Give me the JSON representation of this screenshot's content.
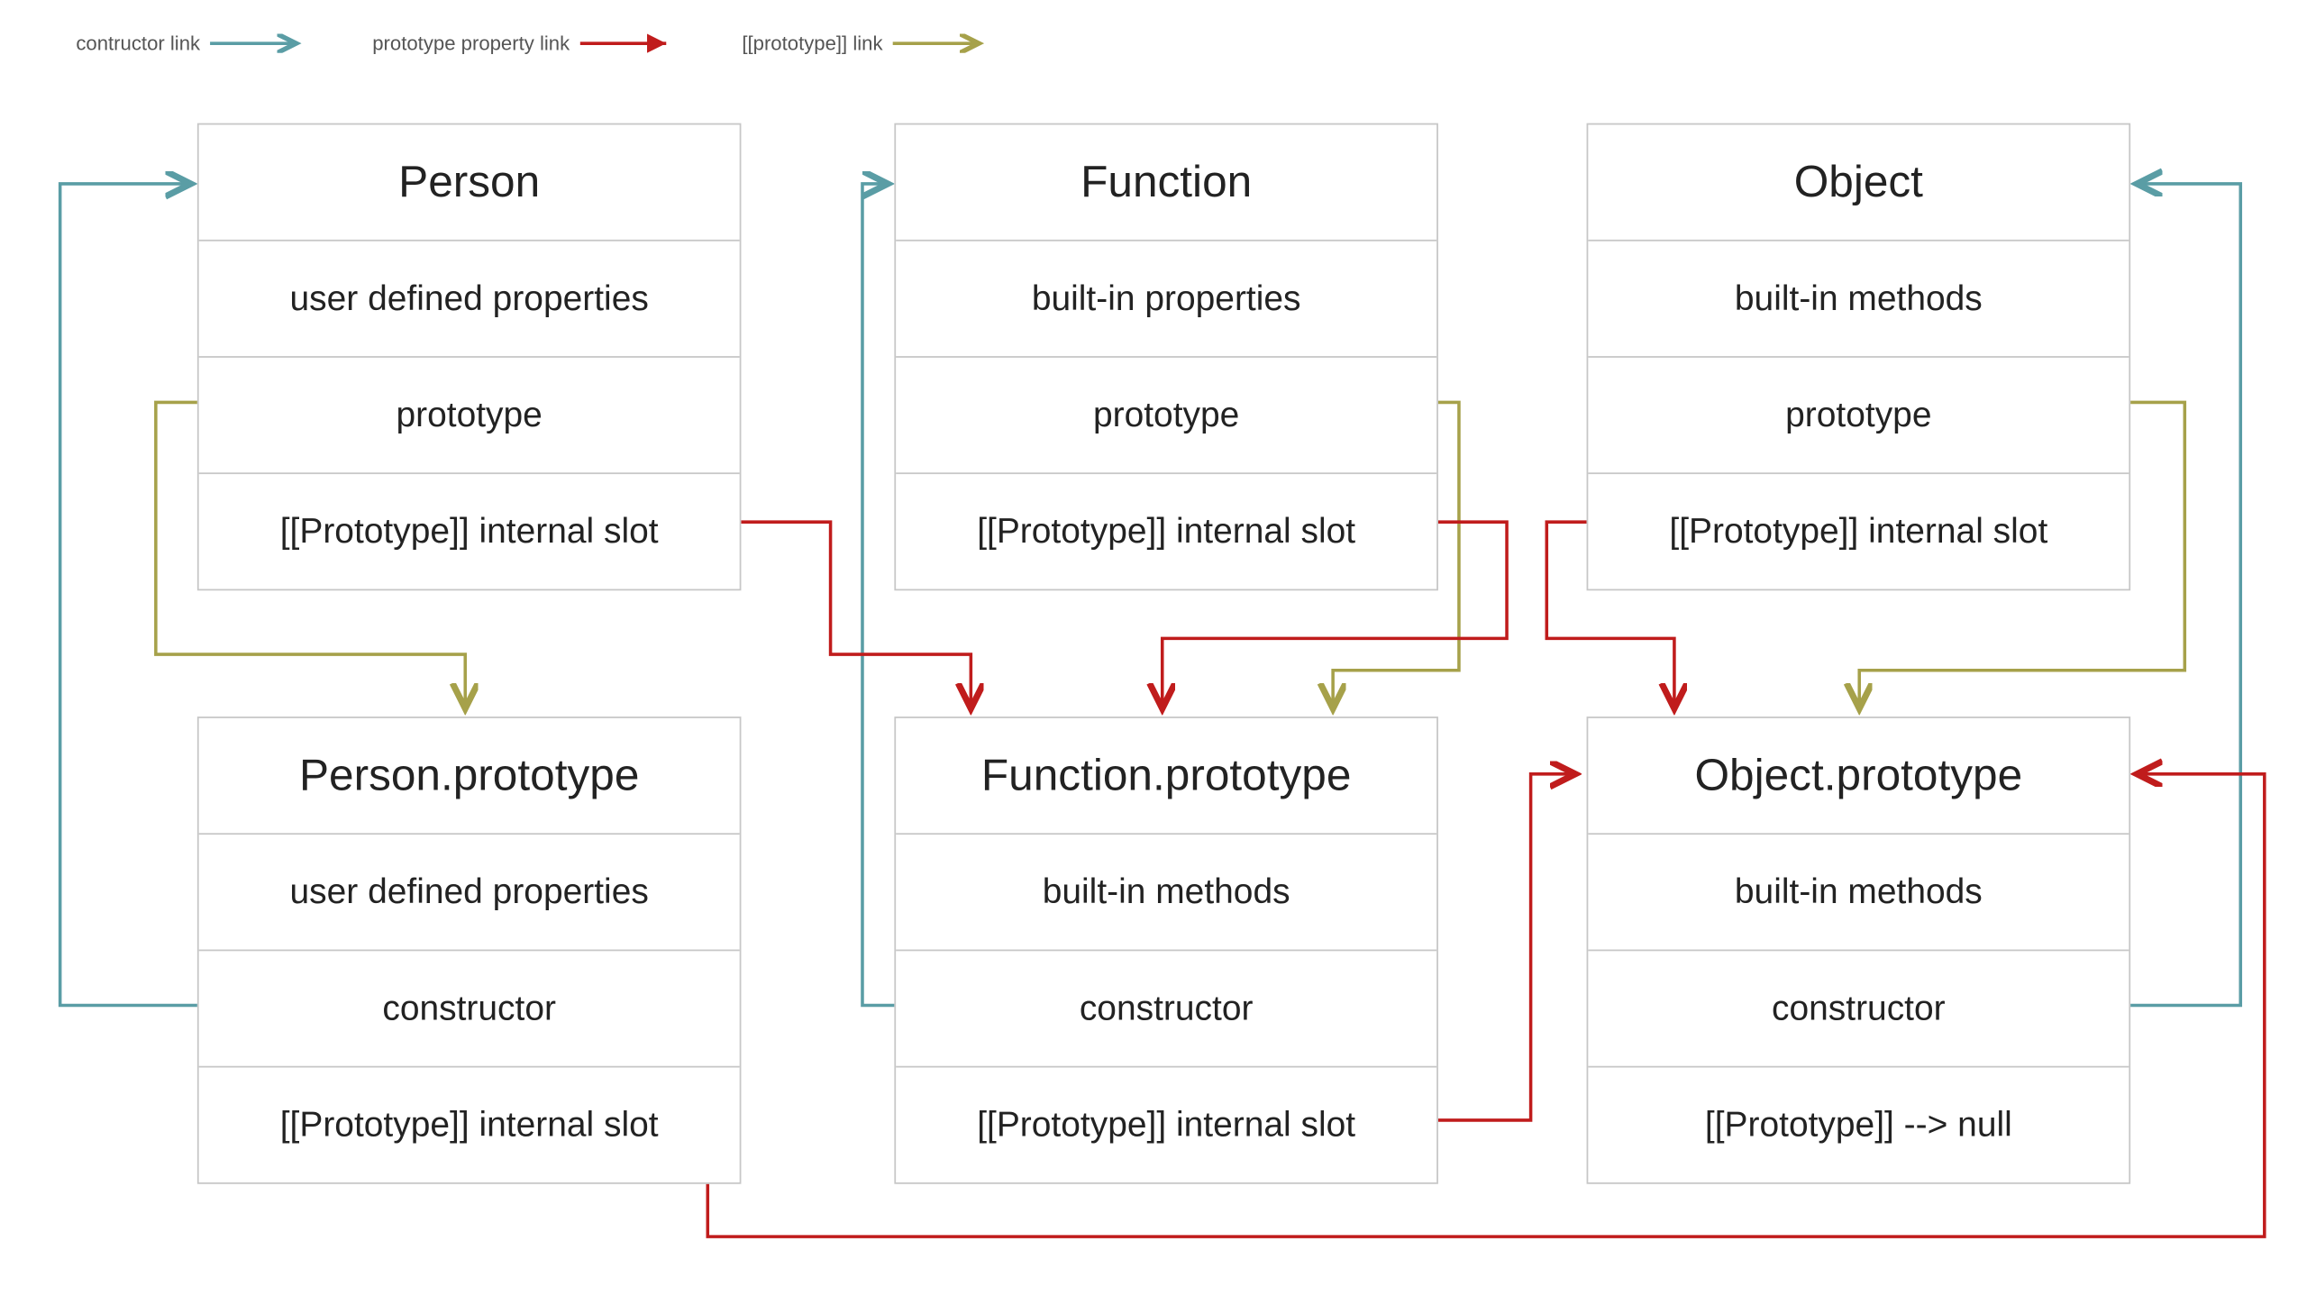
{
  "legend": {
    "constructor": "contructor link",
    "protoprop": "prototype property link",
    "protoslot": "[[prototype]] link"
  },
  "colors": {
    "constructor": "#5a9da5",
    "protoprop": "#c01c1c",
    "protoslot": "#a6a14a"
  },
  "boxes": {
    "person": {
      "title": "Person",
      "r1": "user defined properties",
      "r2": "prototype",
      "r3": "[[Prototype]] internal slot"
    },
    "function": {
      "title": "Function",
      "r1": "built-in properties",
      "r2": "prototype",
      "r3": "[[Prototype]] internal slot"
    },
    "object": {
      "title": "Object",
      "r1": "built-in methods",
      "r2": "prototype",
      "r3": "[[Prototype]] internal slot"
    },
    "personProto": {
      "title": "Person.prototype",
      "r1": "user defined properties",
      "r2": "constructor",
      "r3": "[[Prototype]] internal slot"
    },
    "functionProto": {
      "title": "Function.prototype",
      "r1": "built-in methods",
      "r2": "constructor",
      "r3": "[[Prototype]] internal slot"
    },
    "objectProto": {
      "title": "Object.prototype",
      "r1": "built-in methods",
      "r2": "constructor",
      "r3": "[[Prototype]] --> null"
    }
  }
}
